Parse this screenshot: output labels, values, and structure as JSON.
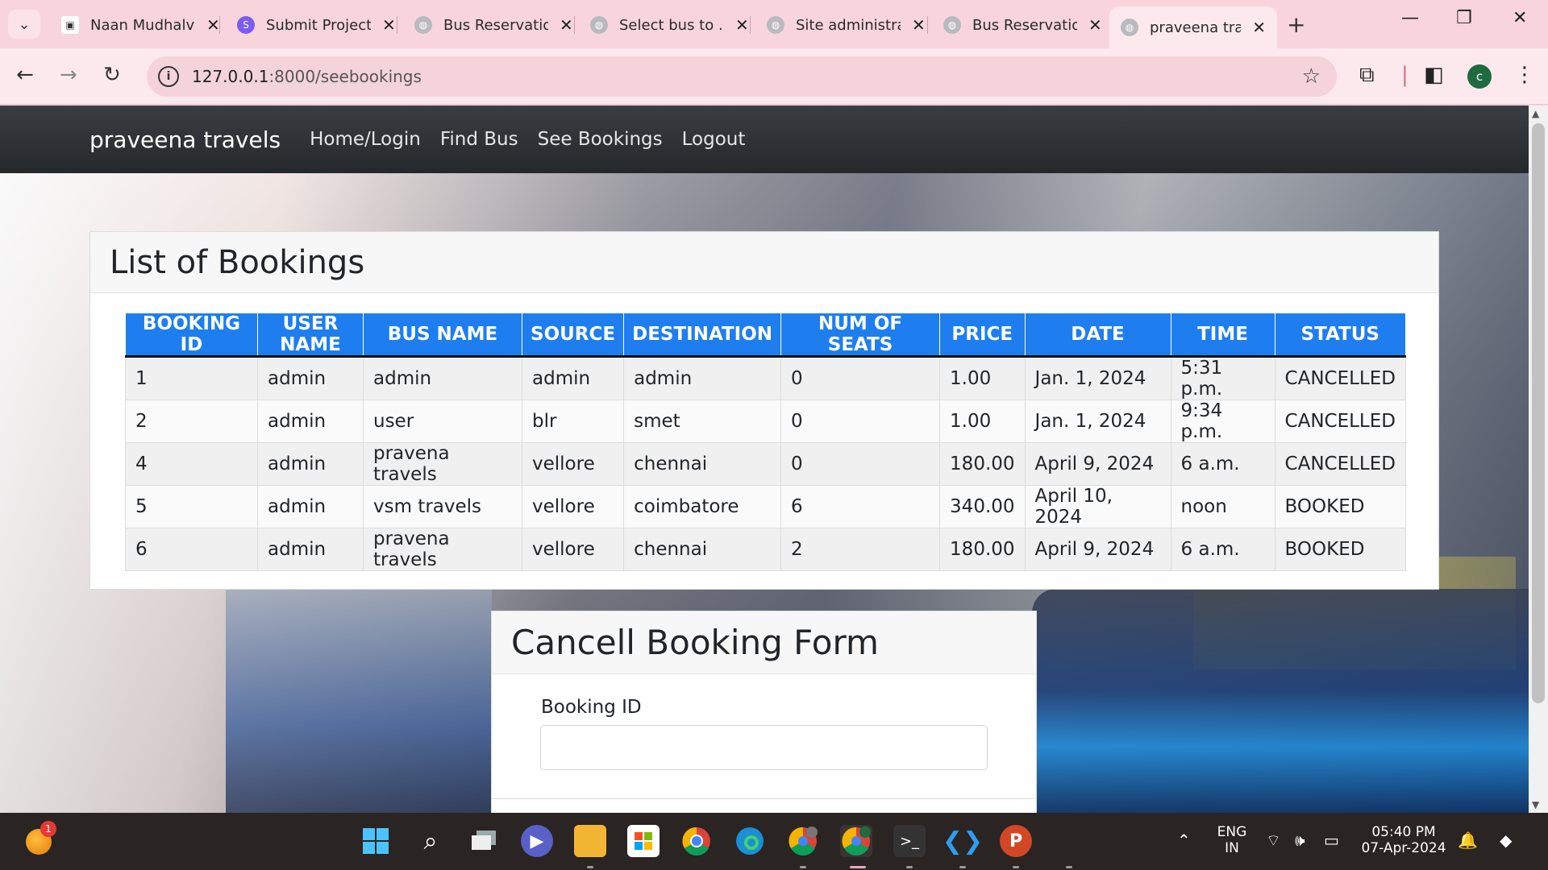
{
  "browser": {
    "tabs": [
      {
        "title": "Naan Mudhalvan",
        "active": false
      },
      {
        "title": "Submit Project",
        "active": false
      },
      {
        "title": "Bus Reservation",
        "active": false
      },
      {
        "title": "Select bus to ...",
        "active": false
      },
      {
        "title": "Site administration",
        "active": false
      },
      {
        "title": "Bus Reservation",
        "active": false
      },
      {
        "title": "praveena travels",
        "active": true
      }
    ],
    "url_host": "127.0.0.1",
    "url_path": ":8000/seebookings",
    "profile_initial": "c"
  },
  "site": {
    "brand": "praveena travels",
    "nav": [
      "Home/Login",
      "Find Bus",
      "See Bookings",
      "Logout"
    ]
  },
  "bookings": {
    "title": "List of Bookings",
    "columns": [
      "BOOKING ID",
      "USER NAME",
      "BUS NAME",
      "SOURCE",
      "DESTINATION",
      "NUM OF SEATS",
      "PRICE",
      "DATE",
      "TIME",
      "STATUS"
    ],
    "rows": [
      [
        "1",
        "admin",
        "admin",
        "admin",
        "admin",
        "0",
        "1.00",
        "Jan. 1, 2024",
        "5:31 p.m.",
        "CANCELLED"
      ],
      [
        "2",
        "admin",
        "user",
        "blr",
        "smet",
        "0",
        "1.00",
        "Jan. 1, 2024",
        "9:34 p.m.",
        "CANCELLED"
      ],
      [
        "4",
        "admin",
        "pravena travels",
        "vellore",
        "chennai",
        "0",
        "180.00",
        "April 9, 2024",
        "6 a.m.",
        "CANCELLED"
      ],
      [
        "5",
        "admin",
        "vsm travels",
        "vellore",
        "coimbatore",
        "6",
        "340.00",
        "April 10, 2024",
        "noon",
        "BOOKED"
      ],
      [
        "6",
        "admin",
        "pravena travels",
        "vellore",
        "chennai",
        "2",
        "180.00",
        "April 9, 2024",
        "6 a.m.",
        "BOOKED"
      ]
    ]
  },
  "cancel_form": {
    "title": "Cancell Booking Form",
    "field_label": "Booking ID",
    "field_value": ""
  },
  "taskbar": {
    "weather_badge": "1",
    "lang_line1": "ENG",
    "lang_line2": "IN",
    "time": "05:40 PM",
    "date": "07-Apr-2024"
  },
  "colors": {
    "table_header": "#1e7ef0",
    "navbar": "#2b2e31",
    "chrome_frame": "#f8d4dc"
  }
}
